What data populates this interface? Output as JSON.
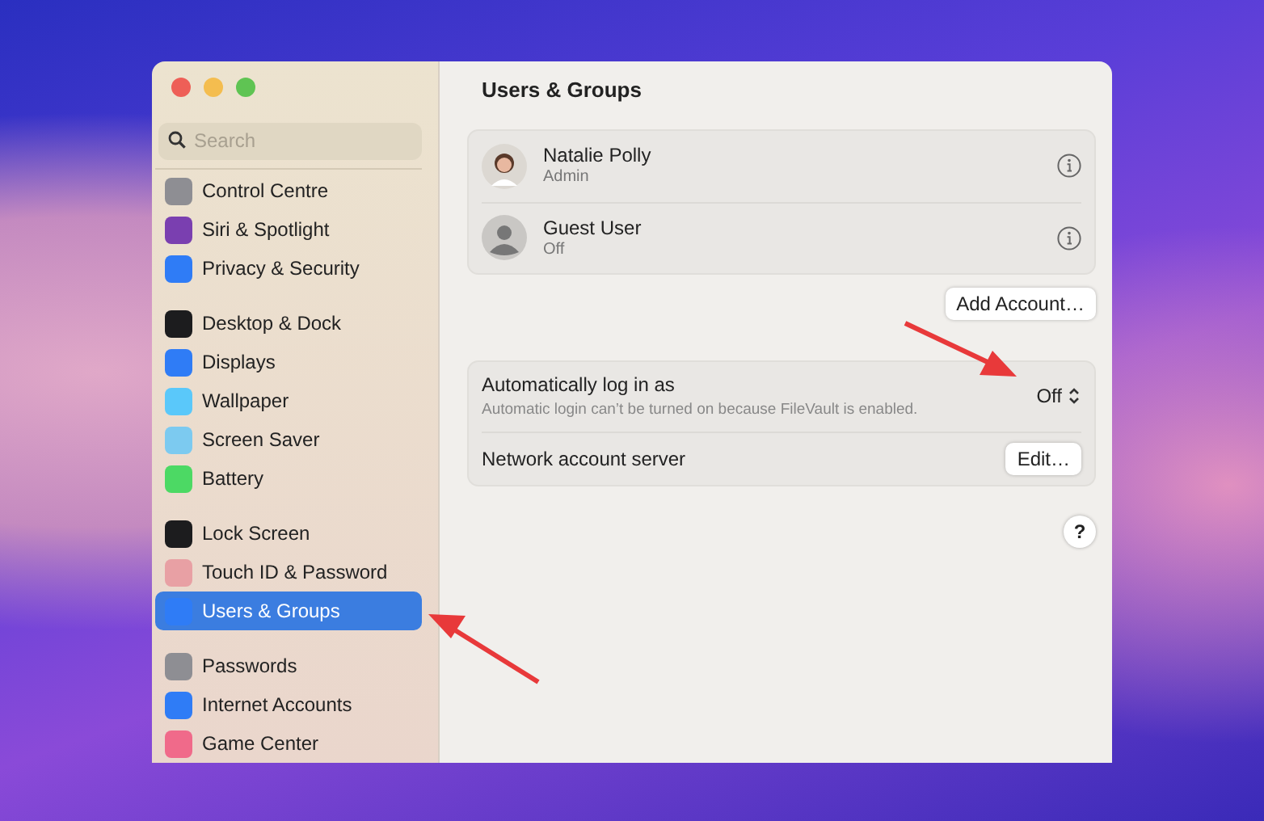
{
  "window": {
    "title": "Users & Groups"
  },
  "sidebar": {
    "search": {
      "placeholder": "Search"
    },
    "sections": [
      {
        "items": [
          {
            "label": "Control Centre",
            "selected": false,
            "color": "#8e8e93"
          },
          {
            "label": "Siri & Spotlight",
            "selected": false,
            "color": "#7a3fb0"
          },
          {
            "label": "Privacy & Security",
            "selected": false,
            "color": "#2f7cf6"
          }
        ]
      },
      {
        "items": [
          {
            "label": "Desktop & Dock",
            "selected": false,
            "color": "#1c1c1e"
          },
          {
            "label": "Displays",
            "selected": false,
            "color": "#2f7cf6"
          },
          {
            "label": "Wallpaper",
            "selected": false,
            "color": "#5ac8fa"
          },
          {
            "label": "Screen Saver",
            "selected": false,
            "color": "#7ccaf0"
          },
          {
            "label": "Battery",
            "selected": false,
            "color": "#4cd964"
          }
        ]
      },
      {
        "items": [
          {
            "label": "Lock Screen",
            "selected": false,
            "color": "#1c1c1e"
          },
          {
            "label": "Touch ID & Password",
            "selected": false,
            "color": "#e8a0a4"
          },
          {
            "label": "Users & Groups",
            "selected": true,
            "color": "#2f7cf6"
          }
        ]
      },
      {
        "items": [
          {
            "label": "Passwords",
            "selected": false,
            "color": "#8e8e93"
          },
          {
            "label": "Internet Accounts",
            "selected": false,
            "color": "#2f7cf6"
          },
          {
            "label": "Game Center",
            "selected": false,
            "color": "#f06a8a"
          }
        ]
      }
    ]
  },
  "users": [
    {
      "name": "Natalie Polly",
      "role": "Admin",
      "kind": "personal"
    },
    {
      "name": "Guest User",
      "role": "Off",
      "kind": "guest"
    }
  ],
  "add_account_button": "Add Account…",
  "auto_login": {
    "label": "Automatically log in as",
    "note": "Automatic login can’t be turned on because FileVault is enabled.",
    "value": "Off"
  },
  "network_server": {
    "label": "Network account server",
    "button": "Edit…"
  },
  "help_button": "?"
}
